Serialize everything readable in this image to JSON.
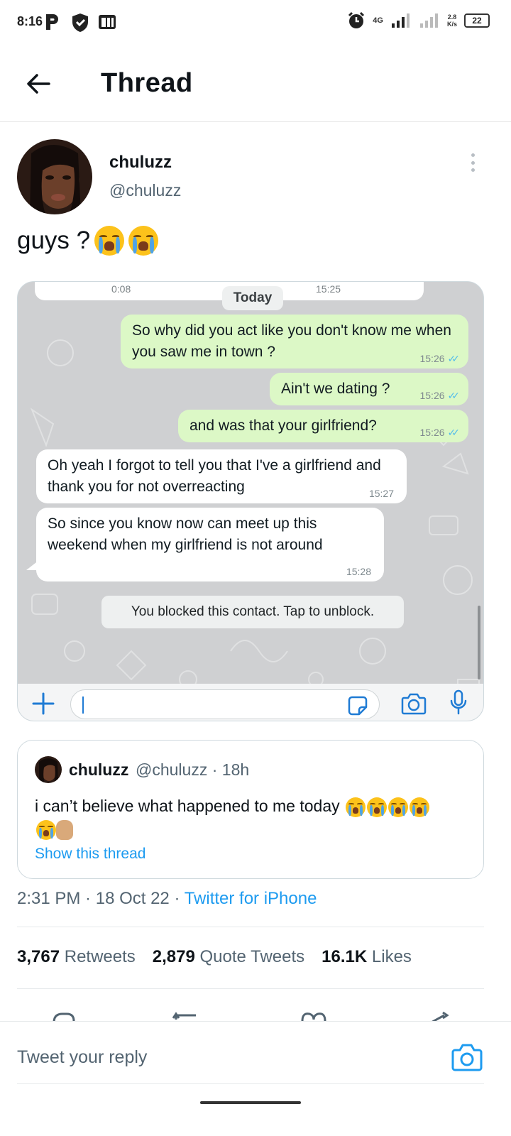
{
  "status_bar": {
    "time": "8:16",
    "network": "4G",
    "speed_value": "2.8",
    "speed_unit": "K/s",
    "battery": "22"
  },
  "header": {
    "title": "Thread"
  },
  "tweet": {
    "author_name": "chuluzz",
    "author_handle": "@chuluzz",
    "text": "guys ?",
    "emojis": [
      "loudly-crying-face",
      "loudly-crying-face"
    ]
  },
  "chat_screenshot": {
    "top_times": [
      "0:08",
      "15:25"
    ],
    "date_chip": "Today",
    "messages": [
      {
        "direction": "out",
        "text": "So why did you act like you don't know me when you saw me in town ?",
        "time": "15:26",
        "read": true
      },
      {
        "direction": "out",
        "text": "Ain't we dating ?",
        "time": "15:26",
        "read": true
      },
      {
        "direction": "out",
        "text": "and was that your girlfriend?",
        "time": "15:26",
        "read": true
      },
      {
        "direction": "in",
        "text": "Oh yeah I forgot to tell you that I've a girlfriend and thank you for not overreacting",
        "time": "15:27"
      },
      {
        "direction": "in",
        "text": "So since you know now can meet up this weekend when my girlfriend is not around",
        "time": "15:28"
      }
    ],
    "blocked_notice": "You blocked this contact. Tap to unblock.",
    "input_value": ""
  },
  "quoted_tweet": {
    "author_name": "chuluzz",
    "author_handle": "@chuluzz",
    "age": "18h",
    "separator": "·",
    "text": "i can’t believe what happened to me today",
    "emojis": [
      "loudly-crying-face",
      "loudly-crying-face",
      "loudly-crying-face",
      "loudly-crying-face",
      "loudly-crying-face",
      "raised-hand"
    ],
    "link": "Show this thread"
  },
  "meta": {
    "time": "2:31 PM",
    "date": "18 Oct 22",
    "separator": " · ",
    "source": "Twitter for iPhone"
  },
  "stats": {
    "retweets_count": "3,767",
    "retweets_label": "Retweets",
    "quotes_count": "2,879",
    "quotes_label": "Quote Tweets",
    "likes_count": "16.1K",
    "likes_label": "Likes"
  },
  "reply": {
    "placeholder": "Tweet your reply"
  },
  "colors": {
    "twitter_blue": "#1d9bf0",
    "outgoing_bubble": "#dcf8c6",
    "read_ticks": "#53bdeb",
    "chat_background": "#cfd0d2"
  }
}
